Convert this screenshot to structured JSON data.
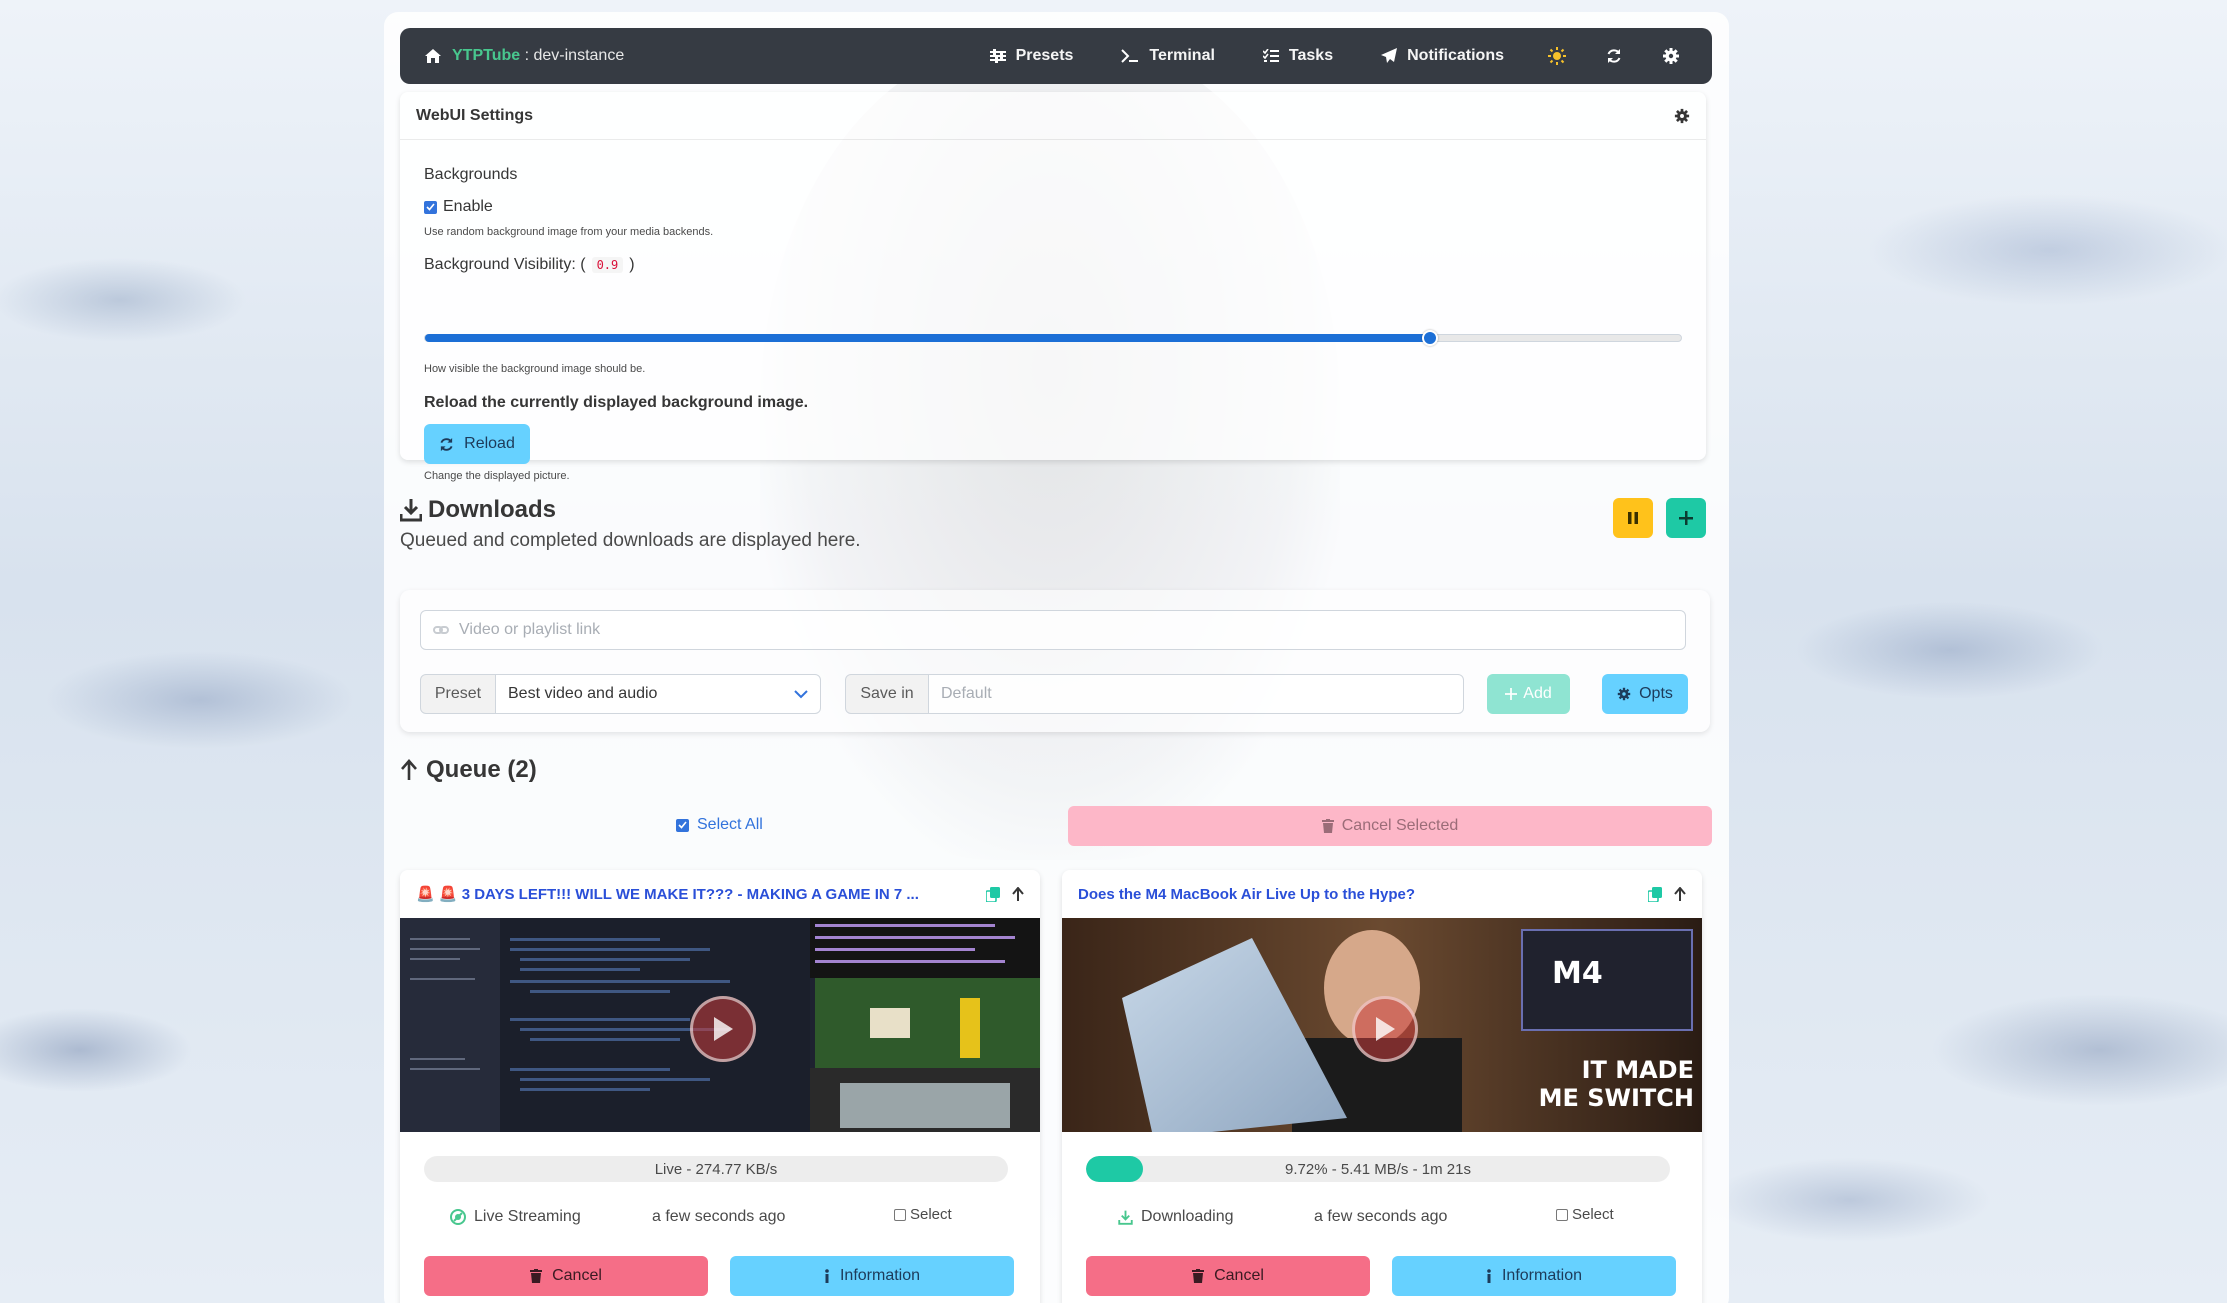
{
  "navbar": {
    "brand_name": "YTPTube",
    "brand_separator": " : ",
    "instance": "dev-instance",
    "items": [
      {
        "label": "Presets",
        "icon": "sliders-icon"
      },
      {
        "label": "Terminal",
        "icon": "terminal-icon"
      },
      {
        "label": "Tasks",
        "icon": "tasks-icon"
      },
      {
        "label": "Notifications",
        "icon": "paper-plane-icon"
      }
    ],
    "icons": [
      "sun-icon",
      "sync-icon",
      "gear-icon"
    ]
  },
  "settings": {
    "title": "WebUI Settings",
    "backgrounds_label": "Backgrounds",
    "enable_label": "Enable",
    "enable_checked": true,
    "enable_help": "Use random background image from your media backends.",
    "visibility_label": "Background Visibility: (",
    "visibility_close": ")",
    "visibility_value": "0.9",
    "visibility_fraction": 0.8,
    "visibility_help": "How visible the background image should be.",
    "reload_label": "Reload the currently displayed background image.",
    "reload_button": "Reload",
    "reload_help": "Change the displayed picture."
  },
  "downloads": {
    "title": "Downloads",
    "subtitle": "Queued and completed downloads are displayed here.",
    "url_placeholder": "Video or playlist link",
    "preset_label": "Preset",
    "preset_value": "Best video and audio",
    "save_in_label": "Save in",
    "save_in_placeholder": "Default",
    "add_button": "Add",
    "opts_button": "Opts"
  },
  "queue": {
    "title": "Queue (2)",
    "select_all": "Select All",
    "cancel_selected": "Cancel Selected",
    "items": [
      {
        "title": "🚨 🚨 3 DAYS LEFT!!! WILL WE MAKE IT??? - MAKING A GAME IN 7 ...",
        "progress_text": "Live - 274.77 KB/s",
        "progress_fraction": 0,
        "status": "Live Streaming",
        "time": "a few seconds ago",
        "select": "Select",
        "cancel": "Cancel",
        "info": "Information"
      },
      {
        "title": "Does the M4 MacBook Air Live Up to the Hype?",
        "progress_text": "9.72% - 5.41 MB/s - 1m 21s",
        "progress_fraction": 0.0972,
        "status": "Downloading",
        "time": "a few seconds ago",
        "select": "Select",
        "cancel": "Cancel",
        "info": "Information",
        "thumb_text_1": "M4",
        "thumb_text_2": "IT MADE",
        "thumb_text_3": "ME SWITCH"
      }
    ]
  },
  "colors": {
    "accent_green": "#48c78e",
    "navbar_bg": "#363b43",
    "info": "#66d1ff",
    "danger": "#f56e87",
    "warning": "#ffc21b",
    "primary": "#1ec9a5",
    "link": "#3273dc"
  }
}
